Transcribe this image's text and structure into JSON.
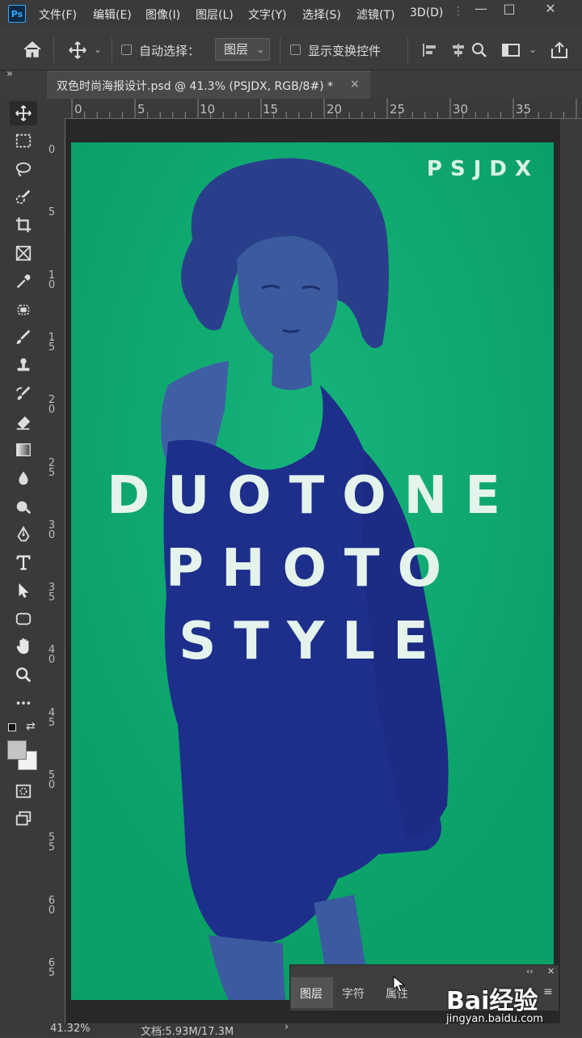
{
  "app": {
    "logo_text": "Ps"
  },
  "menu": [
    "文件(F)",
    "编辑(E)",
    "图像(I)",
    "图层(L)",
    "文字(Y)",
    "选择(S)",
    "滤镜(T)",
    "3D(D)"
  ],
  "window_controls": {
    "minimize": "—",
    "maximize": "□",
    "close": "✕"
  },
  "options_bar": {
    "auto_select_label": "自动选择：",
    "auto_select_target": "图层",
    "show_transform_label": "显示变换控件"
  },
  "panel_handle": "»",
  "document_tab": {
    "title": "双色时尚海报设计.psd @ 41.3% (PSJDX, RGB/8#) *",
    "close": "×"
  },
  "ruler_top_ticks": [
    "0",
    "5",
    "10",
    "15",
    "20",
    "25",
    "30",
    "35"
  ],
  "ruler_left_ticks": [
    "0",
    "5",
    "10",
    "15",
    "20",
    "25",
    "30",
    "35",
    "40",
    "45",
    "50",
    "55",
    "60",
    "65"
  ],
  "artboard": {
    "brand": "PSJDX",
    "headline_lines": [
      "DUOTONE",
      "PHOTO",
      "STYLE"
    ],
    "background_color": "#0ba46a",
    "figure_color": "#1d2f8a"
  },
  "layers_panel": {
    "tabs": [
      "图层",
      "字符",
      "属性"
    ],
    "active_tab": "图层",
    "collapse": "‹‹",
    "close": "✕",
    "menu": "≡"
  },
  "status_bar": {
    "zoom": "41.32%",
    "doc_info": "文档:5.93M/17.3M",
    "arrow": "›"
  },
  "watermark": {
    "brand": "Bai经验",
    "url": "jingyan.baidu.com"
  }
}
